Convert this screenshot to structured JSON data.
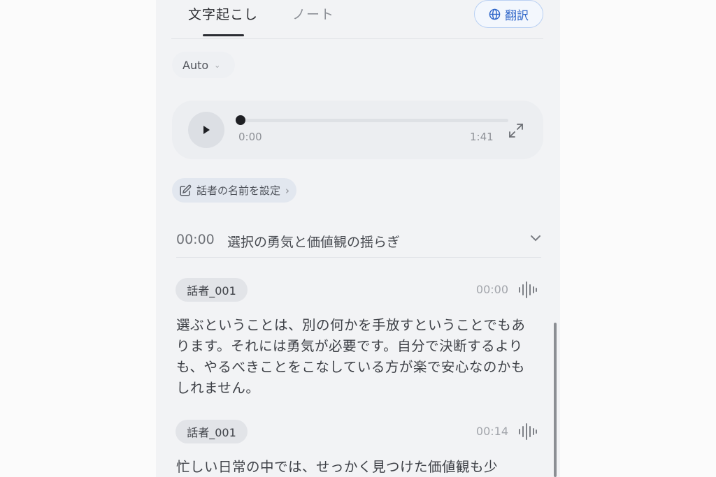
{
  "tabs": [
    {
      "label": "文字起こし",
      "active": true
    },
    {
      "label": "ノート",
      "active": false
    }
  ],
  "translate_label": "翻訳",
  "language_select": "Auto",
  "player": {
    "current_time": "0:00",
    "total_time": "1:41",
    "progress": 0
  },
  "set_speaker_names_label": "話者の名前を設定",
  "chapter": {
    "time": "00:00",
    "title": "選択の勇気と価値観の揺らぎ"
  },
  "segments": [
    {
      "speaker": "話者_001",
      "time": "00:00",
      "text": "選ぶということは、別の何かを手放すということでもあります。それには勇気が必要です。自分で決断するよりも、やるべきことをこなしている方が楽で安心なのかもしれません。"
    },
    {
      "speaker": "話者_001",
      "time": "00:14",
      "text": "忙しい日常の中では、せっかく見つけた価値観も少"
    }
  ],
  "colors": {
    "accent": "#2f66c9",
    "panel": "#f2f3f5"
  },
  "icons": {
    "translate": "globe-icon",
    "play": "play-icon",
    "expand": "expand-icon",
    "edit": "edit-icon",
    "waveform": "waveform-icon"
  }
}
